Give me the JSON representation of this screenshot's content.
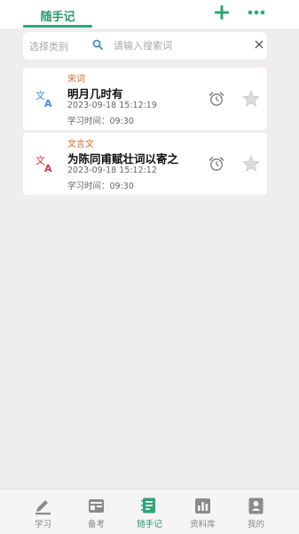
{
  "header": {
    "active_tab": "随手记"
  },
  "search": {
    "category_label": "选择类别",
    "placeholder": "请输入搜索词",
    "value": ""
  },
  "notes": [
    {
      "category": "宋词",
      "title": "明月几时有",
      "date": "2023-09-18 15:12:19",
      "study_label": "学习时间：",
      "study_time": "09:30",
      "icon": "translate-icon",
      "icon_color": "#3d8fd9"
    },
    {
      "category": "文言文",
      "title": "为陈同甫赋壮词以寄之",
      "date": "2023-09-18 15:12:12",
      "study_label": "学习时间：",
      "study_time": "09:30",
      "icon": "translate-icon",
      "icon_color": "#d9363e"
    }
  ],
  "nav": [
    {
      "label": "学习",
      "icon": "pencil-icon",
      "active": false
    },
    {
      "label": "备考",
      "icon": "card-icon",
      "active": false
    },
    {
      "label": "随手记",
      "icon": "notebook-icon",
      "active": true
    },
    {
      "label": "资料库",
      "icon": "chart-icon",
      "active": false
    },
    {
      "label": "我的",
      "icon": "profile-icon",
      "active": false
    }
  ],
  "colors": {
    "accent": "#2aa876",
    "category": "#d9692a",
    "nav_inactive": "#8a8a8a"
  }
}
